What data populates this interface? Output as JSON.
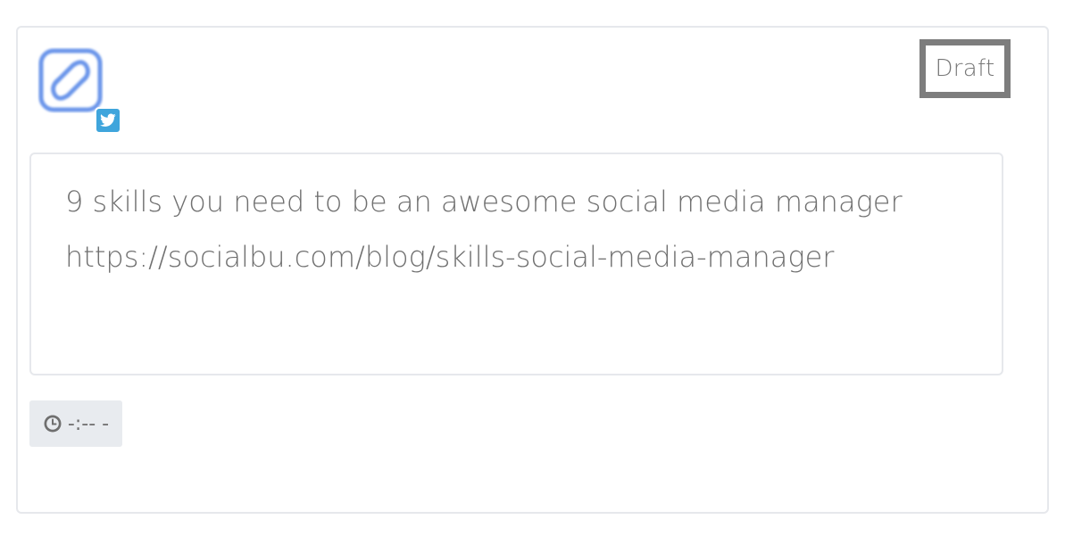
{
  "post": {
    "status": "Draft",
    "text": "9 skills you need to be an awesome social media manager https://socialbu.com/blog/skills-social-media-manager",
    "time": "-:-- -",
    "account_icon": "socialbu-logo-icon",
    "network_icon": "twitter-icon",
    "clock_icon": "clock-icon"
  },
  "colors": {
    "network": "#3fa5dc",
    "status_border": "#7d7d7d",
    "card_border": "#e6e8ec",
    "chip_bg": "#e8ebef"
  }
}
